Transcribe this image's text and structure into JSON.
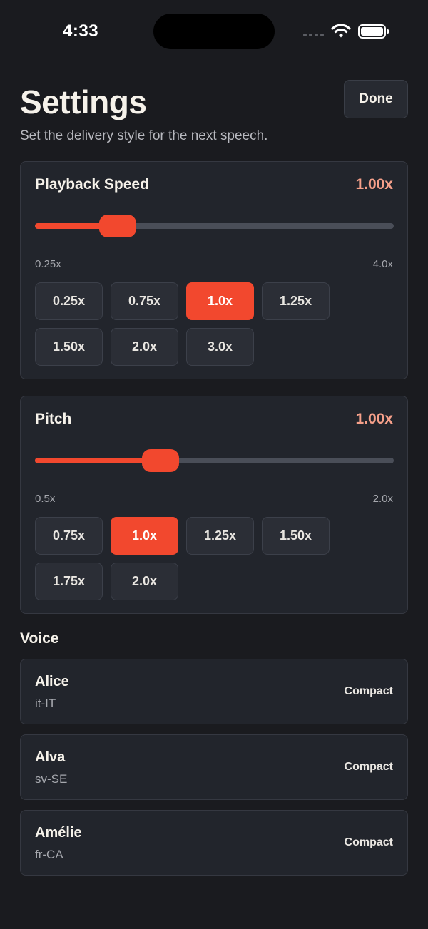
{
  "status_bar": {
    "time": "4:33"
  },
  "header": {
    "title": "Settings",
    "subtitle": "Set the delivery style for the next speech.",
    "done_label": "Done"
  },
  "playback_speed": {
    "title": "Playback Speed",
    "value_label": "1.00x",
    "min_label": "0.25x",
    "max_label": "4.0x",
    "value": 1.0,
    "min": 0.25,
    "max": 4.0,
    "presets": [
      "0.25x",
      "0.75x",
      "1.0x",
      "1.25x",
      "1.50x",
      "2.0x",
      "3.0x"
    ],
    "selected_preset": "1.0x"
  },
  "pitch": {
    "title": "Pitch",
    "value_label": "1.00x",
    "min_label": "0.5x",
    "max_label": "2.0x",
    "value": 1.0,
    "min": 0.5,
    "max": 2.0,
    "presets": [
      "0.75x",
      "1.0x",
      "1.25x",
      "1.50x",
      "1.75x",
      "2.0x"
    ],
    "selected_preset": "1.0x"
  },
  "voice": {
    "section_label": "Voice",
    "items": [
      {
        "name": "Alice",
        "language": "it-IT",
        "quality": "Compact"
      },
      {
        "name": "Alva",
        "language": "sv-SE",
        "quality": "Compact"
      },
      {
        "name": "Amélie",
        "language": "fr-CA",
        "quality": "Compact"
      }
    ]
  },
  "colors": {
    "background": "#1a1b1f",
    "card": "#22252c",
    "accent": "#f2482e",
    "value_text": "#f6a08a"
  }
}
